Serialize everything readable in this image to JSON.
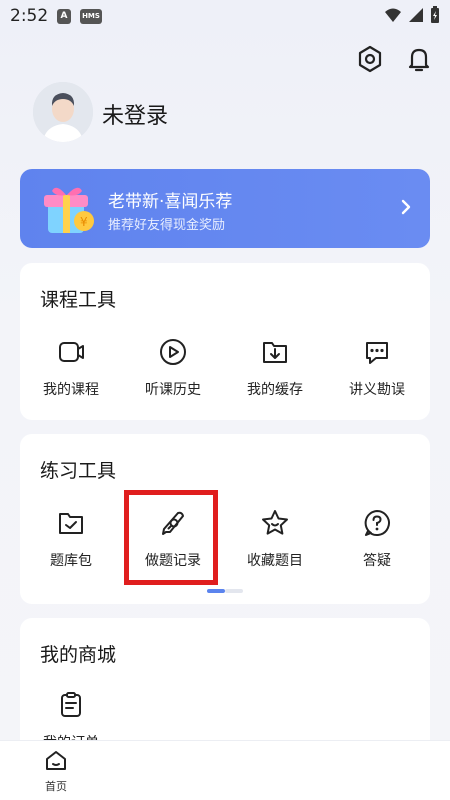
{
  "status": {
    "time": "2:52",
    "badge_a": "A",
    "badge_hms": "HMS"
  },
  "header": {
    "settings_icon": "settings-hex-icon",
    "bell_icon": "bell-icon"
  },
  "profile": {
    "username": "未登录"
  },
  "banner": {
    "title": "老带新·喜闻乐荐",
    "subtitle": "推荐好友得现金奖励",
    "color": "#6688ef"
  },
  "course_tools": {
    "title": "课程工具",
    "items": [
      {
        "label": "我的课程",
        "icon": "video-camera-icon"
      },
      {
        "label": "听课历史",
        "icon": "play-circle-icon"
      },
      {
        "label": "我的缓存",
        "icon": "download-folder-icon"
      },
      {
        "label": "讲义勘误",
        "icon": "chat-dots-icon"
      }
    ]
  },
  "practice_tools": {
    "title": "练习工具",
    "items": [
      {
        "label": "题库包",
        "icon": "folder-check-icon"
      },
      {
        "label": "做题记录",
        "icon": "pen-search-icon"
      },
      {
        "label": "收藏题目",
        "icon": "star-icon"
      },
      {
        "label": "答疑",
        "icon": "question-icon"
      }
    ],
    "page_indicator": {
      "current": 1,
      "total": 2
    }
  },
  "mall": {
    "title": "我的商城",
    "items": [
      {
        "label": "我的订单",
        "icon": "clipboard-icon"
      }
    ]
  },
  "bottom_nav": {
    "home_label": "首页"
  },
  "accent": "#5b84ee",
  "highlight_color": "#e01e1e"
}
